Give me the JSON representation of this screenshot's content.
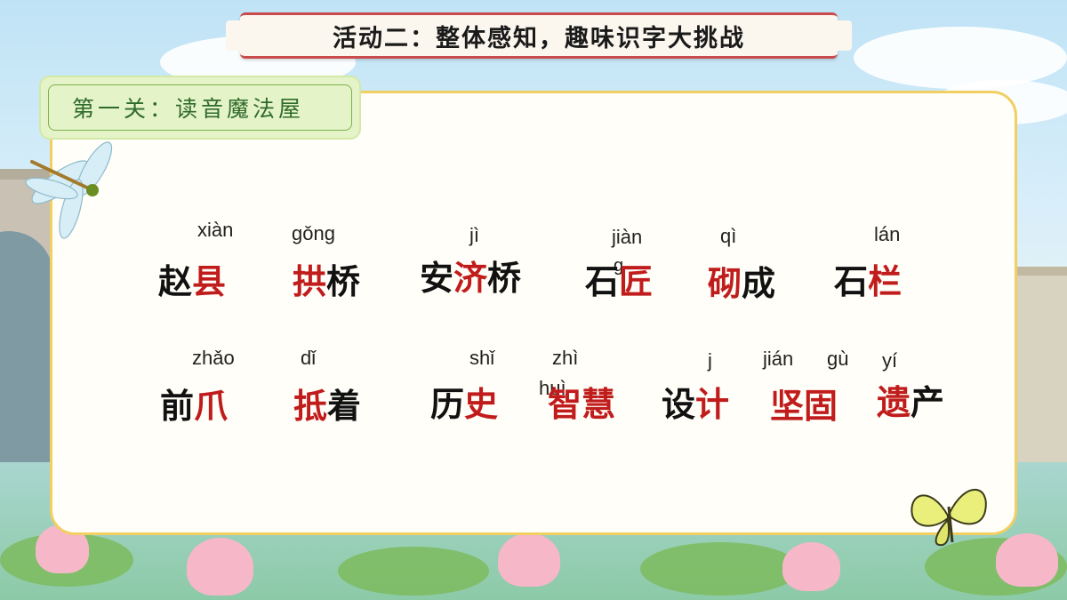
{
  "title": "活动二：整体感知，趣味识字大挑战",
  "level": "第一关：读音魔法屋",
  "row1": {
    "pinyin": [
      "xiàn",
      "gǒng",
      "jì",
      "jiàn",
      "qì",
      "lán"
    ],
    "words": [
      {
        "a": "赵",
        "b": "县"
      },
      {
        "a": "拱",
        "b": "桥"
      },
      {
        "a": "安",
        "b": "济",
        "c": "桥"
      },
      {
        "a": "石",
        "b": "匠"
      },
      {
        "a": "砌",
        "b": "成"
      },
      {
        "a": "石",
        "b": "栏"
      }
    ]
  },
  "row2": {
    "pinyin": [
      "zhǎo",
      "dǐ",
      "shǐ",
      "zhì",
      "huì",
      "j",
      "jián",
      "gù",
      "yí"
    ],
    "words": [
      {
        "a": "前",
        "b": "爪"
      },
      {
        "a": "抵",
        "b": "着"
      },
      {
        "a": "历",
        "b": "史"
      },
      {
        "a": "智慧"
      },
      {
        "a": "设",
        "b": "计"
      },
      {
        "a": "坚固"
      },
      {
        "a": "遗",
        "b": "产"
      }
    ]
  },
  "colors": {
    "accent_red": "#c11c1c",
    "card_border": "#f2cf62",
    "tag_green": "#e5f3c9",
    "banner_red": "#c94b4b"
  },
  "icons": [
    "dragonfly-icon",
    "butterfly-icon"
  ]
}
